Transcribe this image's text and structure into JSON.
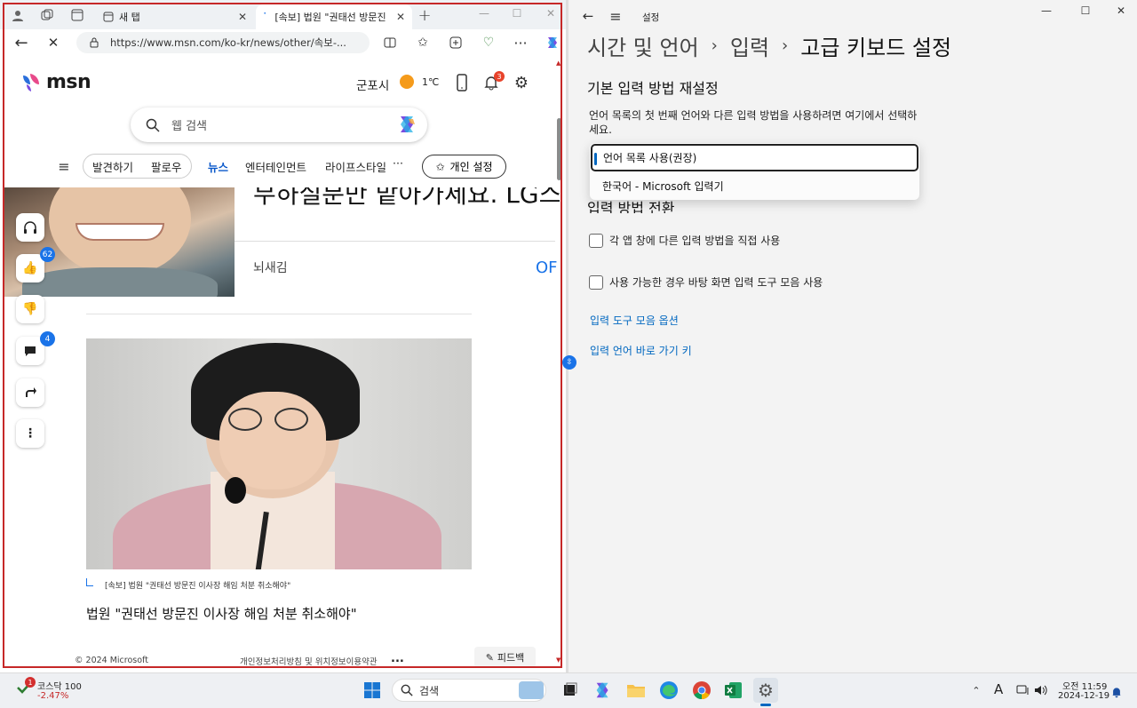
{
  "browser": {
    "tabs": [
      {
        "label": "새 탭"
      },
      {
        "label": "[속보] 법원 \"권태선 방문진"
      }
    ],
    "new_tab": "+",
    "url": "https://www.msn.com/ko-kr/news/other/속보-..."
  },
  "msn": {
    "logo_text": "msn",
    "location": "군포시",
    "temperature": "1℃",
    "notification_count": "3",
    "search_placeholder": "웹 검색",
    "nav": {
      "discover": "발견하기",
      "follow": "팔로우",
      "news": "뉴스",
      "entertainment": "엔터테인먼트",
      "lifestyle": "라이프스타일",
      "more": "···",
      "personalize": "개인 설정"
    },
    "ad_headline": "무하실분만 맡아가세요. LG스탠",
    "ad_source": "뇌새김",
    "ad_cta": "OF",
    "like_count": "62",
    "comment_count": "4",
    "caption": "[속보] 법원 \"권태선 방문진 이사장 해임 처분 취소해야\"",
    "headline": "법원 \"권태선 방문진 이사장 해임 처분 취소해야\"",
    "footer_copyright": "© 2024 Microsoft",
    "footer_links": "개인정보처리방침 및 위치정보이용약관",
    "footer_more": "...",
    "feedback": "피드백"
  },
  "settings": {
    "app_title": "설정",
    "breadcrumb": [
      "시간 및 언어",
      "입력",
      "고급 키보드 설정"
    ],
    "sep": "›",
    "section_default": "기본 입력 방법 재설정",
    "description": "언어 목록의 첫 번째 언어와 다른 입력 방법을 사용하려면 여기에서 선택하세요.",
    "dropdown_options": [
      "언어 목록 사용(권장)",
      "한국어 - Microsoft 입력기"
    ],
    "section_switch": "입력 방법 전환",
    "checkbox1": "각 앱 창에 다른 입력 방법을 직접 사용",
    "checkbox2": "사용 가능한 경우 바탕 화면 입력 도구 모음 사용",
    "link1": "입력 도구 모음 옵션",
    "link2": "입력 언어 바로 가기 키"
  },
  "taskbar": {
    "stock_name": "코스닥 100",
    "stock_change": "-2.47%",
    "stock_badge": "1",
    "search_label": "검색",
    "ime": "A",
    "time": "오전 11:59",
    "date": "2024-12-19"
  }
}
